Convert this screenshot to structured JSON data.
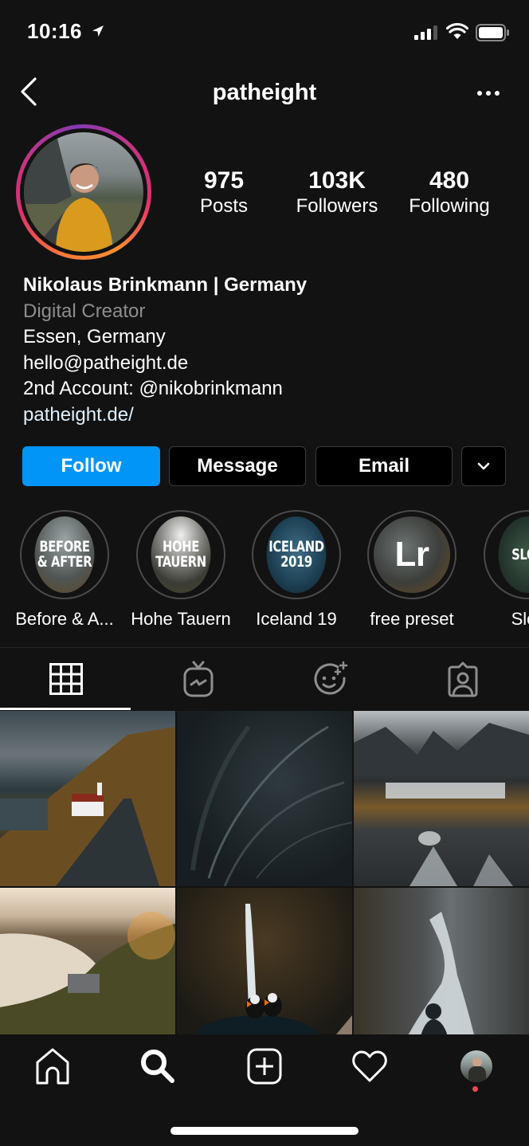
{
  "status_bar": {
    "time": "10:16",
    "icons": [
      "location-arrow-icon",
      "cellular-signal-icon",
      "wifi-icon",
      "battery-icon"
    ]
  },
  "header": {
    "username": "patheight",
    "back_icon": "chevron-left-icon",
    "more_icon": "ellipsis-icon"
  },
  "profile": {
    "stats": [
      {
        "value": "975",
        "label": "Posts"
      },
      {
        "value": "103K",
        "label": "Followers"
      },
      {
        "value": "480",
        "label": "Following"
      }
    ],
    "bio": {
      "name": "Nikolaus Brinkmann | Germany",
      "category": "Digital Creator",
      "lines": [
        "Essen, Germany",
        "hello@patheight.de",
        "2nd Account: @nikobrinkmann",
        "patheight.de/"
      ]
    }
  },
  "actions": {
    "follow": "Follow",
    "message": "Message",
    "email": "Email",
    "more_icon": "chevron-down-icon"
  },
  "highlights": [
    {
      "cover_text": "BEFORE\n& AFTER",
      "label": "Before & A..."
    },
    {
      "cover_text": "HOHE\nTAUERN",
      "label": "Hohe Tauern"
    },
    {
      "cover_text": "ICELAND\n2019",
      "label": "Iceland 19"
    },
    {
      "cover_text": "Lr",
      "label": "free preset"
    },
    {
      "cover_text": "SLOV",
      "label": "Slov"
    }
  ],
  "tabs": [
    {
      "name": "posts-grid",
      "icon": "grid-icon",
      "active": true
    },
    {
      "name": "igtv",
      "icon": "igtv-icon",
      "active": false
    },
    {
      "name": "effects",
      "icon": "effects-face-icon",
      "active": false
    },
    {
      "name": "tagged",
      "icon": "tagged-person-icon",
      "active": false
    }
  ],
  "posts": [
    {
      "description": "Road with red church by fjord"
    },
    {
      "description": "Dark grass with dew drops"
    },
    {
      "description": "Mountain waterfall stream"
    },
    {
      "description": "Sunset over lake and forest"
    },
    {
      "description": "Puffins in front of waterfall"
    },
    {
      "description": "Hiker at misty waterfall"
    }
  ],
  "bottom_nav": [
    {
      "icon": "home-icon"
    },
    {
      "icon": "search-icon",
      "active": true
    },
    {
      "icon": "new-post-icon"
    },
    {
      "icon": "activity-heart-icon"
    },
    {
      "icon": "profile-avatar-icon",
      "badge": true
    }
  ],
  "colors": {
    "background": "#121212",
    "accent": "#0095f6",
    "muted_text": "#8e8e8e",
    "notification_dot": "#ed4956"
  }
}
